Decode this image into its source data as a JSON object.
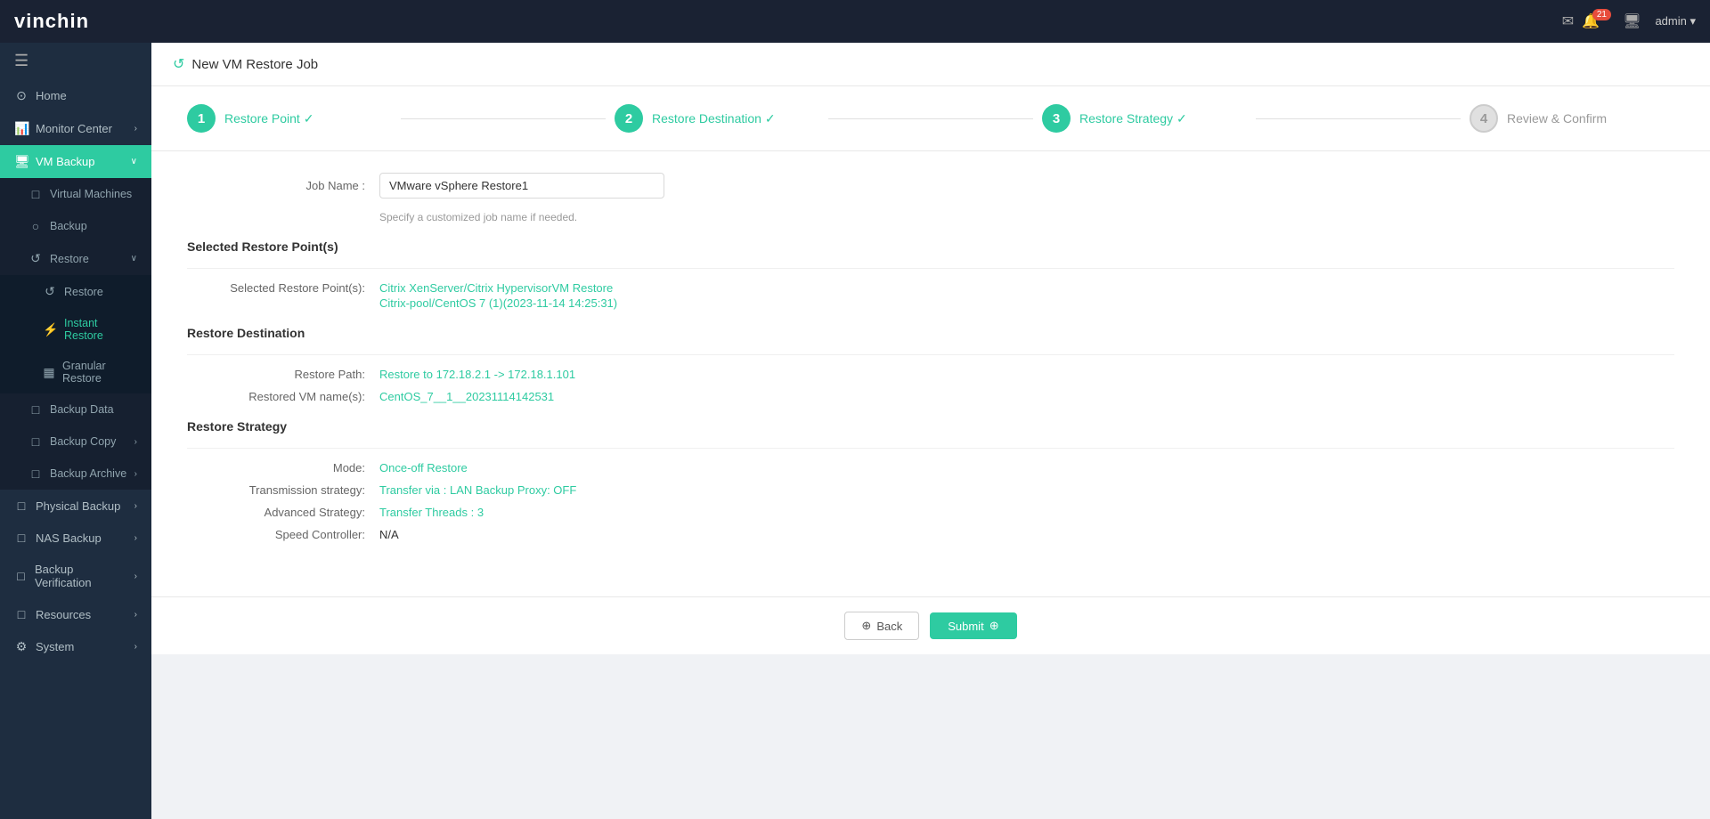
{
  "brand": {
    "text_vin": "vin",
    "text_chin": "chin"
  },
  "navbar": {
    "notification_count": "21",
    "admin_label": "admin ▾"
  },
  "sidebar": {
    "toggle_icon": "☰",
    "items": [
      {
        "id": "home",
        "label": "Home",
        "icon": "⊙",
        "active": false
      },
      {
        "id": "monitor-center",
        "label": "Monitor Center",
        "icon": "📊",
        "active": false,
        "has_chevron": true
      },
      {
        "id": "vm-backup",
        "label": "VM Backup",
        "icon": "🖥",
        "active": true,
        "has_chevron": true
      },
      {
        "id": "virtual-machines",
        "label": "Virtual Machines",
        "icon": "□",
        "active": false,
        "sub": true
      },
      {
        "id": "backup",
        "label": "Backup",
        "icon": "○",
        "active": false,
        "sub": true
      },
      {
        "id": "restore",
        "label": "Restore",
        "icon": "↺",
        "active": false,
        "sub": true,
        "has_chevron": true
      },
      {
        "id": "restore-sub",
        "label": "Restore",
        "icon": "↺",
        "active": false,
        "sub2": true
      },
      {
        "id": "instant-restore",
        "label": "Instant Restore",
        "icon": "⚡",
        "active": false,
        "sub2": true
      },
      {
        "id": "granular-restore",
        "label": "Granular Restore",
        "icon": "▦",
        "active": false,
        "sub2": true
      },
      {
        "id": "backup-data",
        "label": "Backup Data",
        "icon": "□",
        "active": false,
        "sub": true
      },
      {
        "id": "backup-copy",
        "label": "Backup Copy",
        "icon": "□",
        "active": false,
        "sub": true,
        "has_chevron": true
      },
      {
        "id": "backup-archive",
        "label": "Backup Archive",
        "icon": "□",
        "active": false,
        "sub": true,
        "has_chevron": true
      },
      {
        "id": "physical-backup",
        "label": "Physical Backup",
        "icon": "□",
        "active": false,
        "has_chevron": true
      },
      {
        "id": "nas-backup",
        "label": "NAS Backup",
        "icon": "□",
        "active": false,
        "has_chevron": true
      },
      {
        "id": "backup-verification",
        "label": "Backup Verification",
        "icon": "□",
        "active": false,
        "has_chevron": true
      },
      {
        "id": "resources",
        "label": "Resources",
        "icon": "□",
        "active": false,
        "has_chevron": true
      },
      {
        "id": "system",
        "label": "System",
        "icon": "⚙",
        "active": false,
        "has_chevron": true
      }
    ]
  },
  "page": {
    "header": "New VM Restore Job",
    "refresh_icon": "↺"
  },
  "wizard": {
    "steps": [
      {
        "number": "1",
        "label": "Restore Point ✓",
        "state": "active"
      },
      {
        "number": "2",
        "label": "Restore Destination ✓",
        "state": "active"
      },
      {
        "number": "3",
        "label": "Restore Strategy ✓",
        "state": "active"
      },
      {
        "number": "4",
        "label": "Review & Confirm",
        "state": "inactive"
      }
    ]
  },
  "form": {
    "job_name_label": "Job Name :",
    "job_name_value": "VMware vSphere Restore1",
    "job_name_placeholder": "VMware vSphere Restore1",
    "job_name_hint": "Specify a customized job name if needed.",
    "selected_restore_points_title": "Selected Restore Point(s)",
    "selected_restore_points_label": "Selected Restore Point(s):",
    "selected_restore_points_line1": "Citrix XenServer/Citrix HypervisorVM Restore",
    "selected_restore_points_line2": "Citrix-pool/CentOS 7 (1)(2023-11-14 14:25:31)",
    "restore_destination_title": "Restore Destination",
    "restore_path_label": "Restore Path:",
    "restore_path_value": "Restore to 172.18.2.1 -> 172.18.1.101",
    "restored_vm_label": "Restored VM name(s):",
    "restored_vm_value": "CentOS_7__1__20231114142531",
    "restore_strategy_title": "Restore Strategy",
    "mode_label": "Mode:",
    "mode_value": "Once-off Restore",
    "transmission_label": "Transmission strategy:",
    "transmission_value": "Transfer via : LAN Backup Proxy: OFF",
    "advanced_label": "Advanced Strategy:",
    "advanced_value": "Transfer Threads : 3",
    "speed_label": "Speed Controller:",
    "speed_value": "N/A"
  },
  "footer": {
    "back_label": "Back",
    "submit_label": "Submit"
  }
}
